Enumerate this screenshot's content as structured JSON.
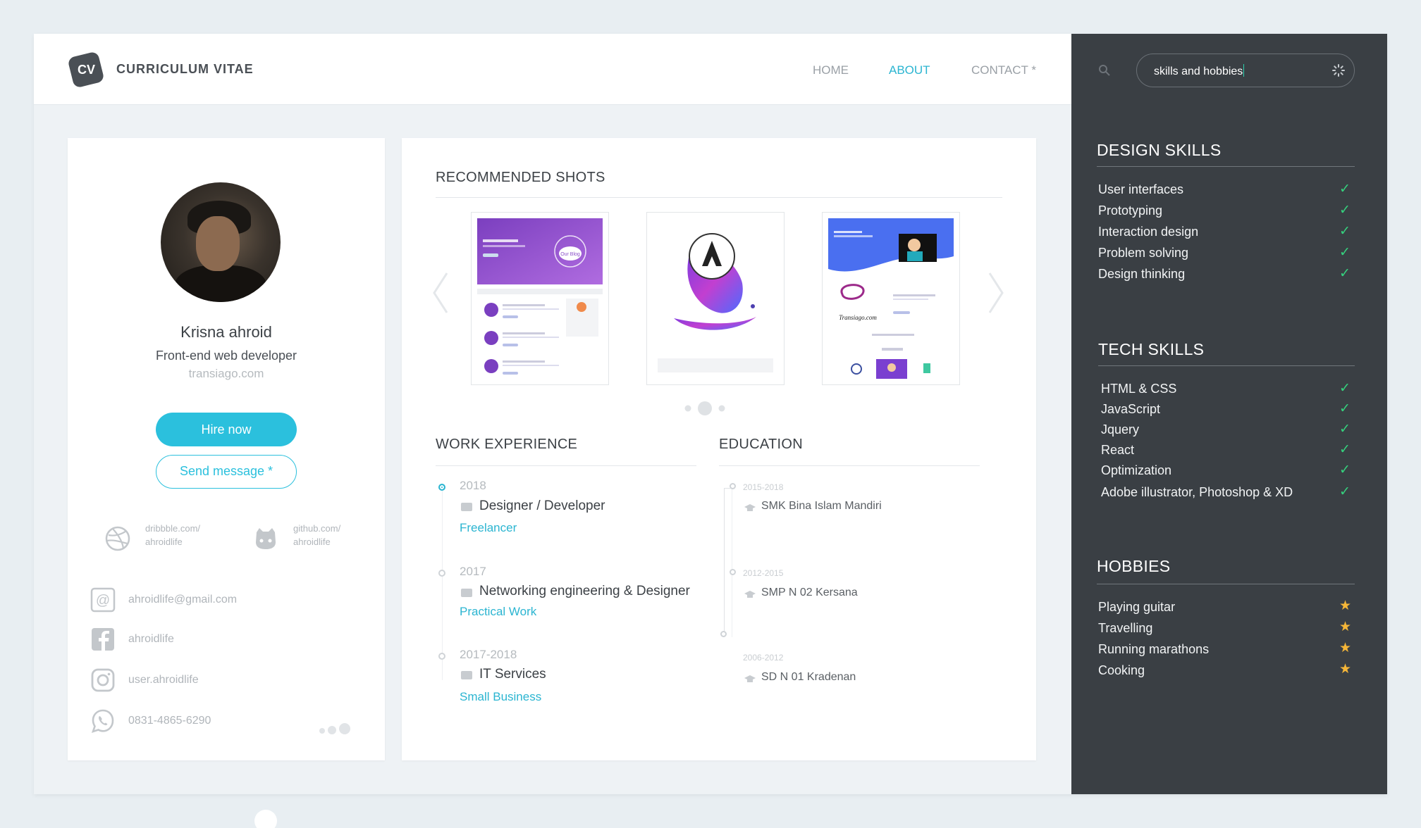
{
  "header": {
    "logo_text": "CV",
    "brand": "CURRICULUM VITAE",
    "nav": [
      {
        "label": "HOME"
      },
      {
        "label": "ABOUT"
      },
      {
        "label": "CONTACT *"
      }
    ]
  },
  "profile": {
    "name": "Krisna ahroid",
    "role": "Front-end web developer",
    "site": "transiago.com",
    "hire_label": "Hire now",
    "message_label": "Send message *",
    "dribbble": {
      "line1": "dribbble.com/",
      "line2": "ahroidlife"
    },
    "github": {
      "line1": "github.com/",
      "line2": "ahroidlife"
    },
    "contacts": [
      {
        "icon": "at-icon",
        "text": "ahroidlife@gmail.com"
      },
      {
        "icon": "facebook-icon",
        "text": "ahroidlife"
      },
      {
        "icon": "instagram-icon",
        "text": "user.ahroidlife"
      },
      {
        "icon": "whatsapp-icon",
        "text": "0831-4865-6290"
      }
    ]
  },
  "shots": {
    "title": "RECOMMENDED SHOTS",
    "items": [
      {
        "thumb_label": "Our Blog"
      },
      {
        "thumb_label": ""
      },
      {
        "thumb_label": "Transiago.com"
      }
    ]
  },
  "work": {
    "title": "WORK EXPERIENCE",
    "items": [
      {
        "year": "2018",
        "title": "Designer / Developer",
        "sub": "Freelancer"
      },
      {
        "year": "2017",
        "title": "Networking engineering & Designer",
        "sub": "Practical Work"
      },
      {
        "year": "2017-2018",
        "title": "IT Services",
        "sub": "Small Business"
      }
    ]
  },
  "education": {
    "title": "EDUCATION",
    "items": [
      {
        "year": "2015-2018",
        "title": "SMK Bina Islam Mandiri"
      },
      {
        "year": "2012-2015",
        "title": "SMP N 02 Kersana"
      },
      {
        "year": "2006-2012",
        "title": "SD N 01 Kradenan"
      }
    ]
  },
  "sidebar": {
    "search_value": "skills and hobbies",
    "design": {
      "title": "DESIGN SKILLS",
      "items": [
        "User interfaces",
        "Prototyping",
        "Interaction design",
        "Problem solving",
        "Design thinking"
      ]
    },
    "tech": {
      "title": "TECH SKILLS",
      "items": [
        "HTML & CSS",
        "JavaScript",
        "Jquery",
        "React",
        "Optimization",
        "Adobe illustrator, Photoshop & XD"
      ]
    },
    "hobbies": {
      "title": "HOBBIES",
      "items": [
        "Playing guitar",
        "Travelling",
        "Running marathons",
        "Cooking"
      ]
    }
  },
  "colors": {
    "accent": "#2bc0dd",
    "sidebar_bg": "#3a3f44",
    "check": "#35d27e",
    "star": "#f5b638"
  }
}
